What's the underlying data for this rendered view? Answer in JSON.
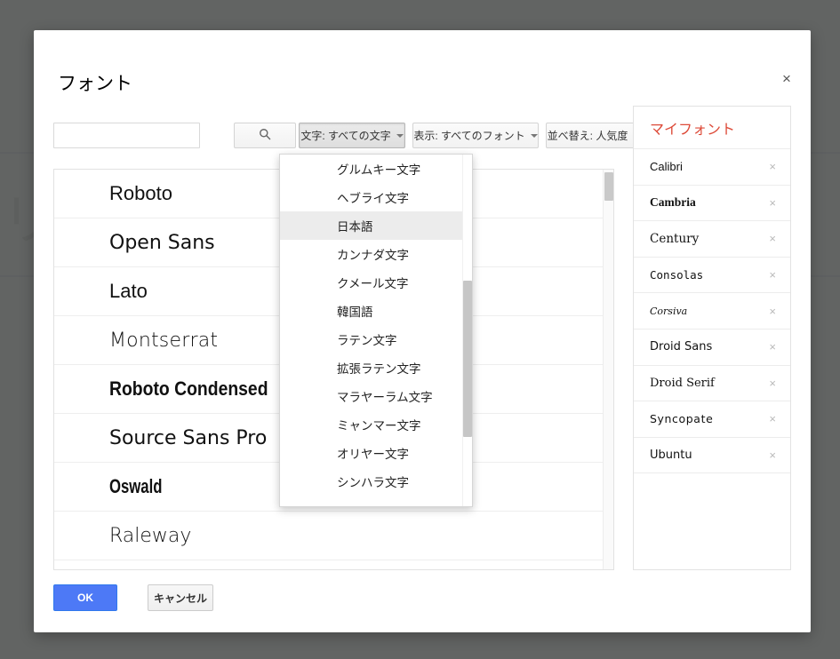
{
  "background": {
    "glyph": "リ",
    "rule_color": "#2f4f9e"
  },
  "dialog": {
    "title": "フォント",
    "close_label": "×"
  },
  "toolbar": {
    "search": {
      "value": "",
      "placeholder": ""
    },
    "search_button_icon": "search-icon",
    "script_filter": {
      "label": "文字: すべての文字",
      "open": true
    },
    "display_filter": {
      "label": "表示: すべてのフォント",
      "open": false
    },
    "sort_filter": {
      "label": "並べ替え: 人気度",
      "open": false
    }
  },
  "script_dropdown": {
    "selected": "日本語",
    "items": [
      {
        "label": "グルムキー文字"
      },
      {
        "label": "ヘブライ文字"
      },
      {
        "label": "日本語"
      },
      {
        "label": "カンナダ文字"
      },
      {
        "label": "クメール文字"
      },
      {
        "label": "韓国語"
      },
      {
        "label": "ラテン文字"
      },
      {
        "label": "拡張ラテン文字"
      },
      {
        "label": "マラヤーラム文字"
      },
      {
        "label": "ミャンマー文字"
      },
      {
        "label": "オリヤー文字"
      },
      {
        "label": "シンハラ文字"
      }
    ]
  },
  "font_list": {
    "items": [
      {
        "name": "Roboto"
      },
      {
        "name": "Open Sans"
      },
      {
        "name": "Lato"
      },
      {
        "name": "Montserrat"
      },
      {
        "name": "Roboto Condensed"
      },
      {
        "name": "Source Sans Pro"
      },
      {
        "name": "Oswald"
      },
      {
        "name": "Raleway"
      }
    ]
  },
  "my_fonts": {
    "title": "マイフォント",
    "title_color": "#dd4b39",
    "remove_label": "×",
    "items": [
      {
        "name": "Calibri"
      },
      {
        "name": "Cambria"
      },
      {
        "name": "Century"
      },
      {
        "name": "Consolas"
      },
      {
        "name": "Corsiva"
      },
      {
        "name": "Droid Sans"
      },
      {
        "name": "Droid Serif"
      },
      {
        "name": "Syncopate"
      },
      {
        "name": "Ubuntu"
      }
    ]
  },
  "footer": {
    "ok_label": "OK",
    "cancel_label": "キャンセル",
    "ok_color": "#4d79f6"
  }
}
